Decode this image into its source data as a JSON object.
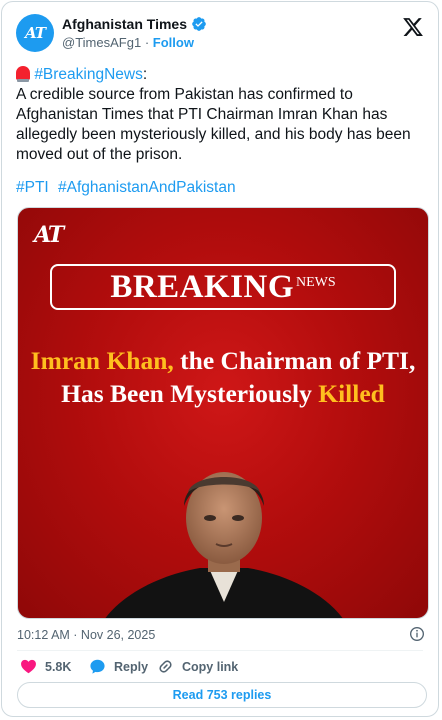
{
  "account": {
    "avatar_text": "AT",
    "name": "Afghanistan Times",
    "handle": "@TimesAFg1",
    "separator": "·",
    "follow_label": "Follow"
  },
  "tweet": {
    "breaking_tag": "#BreakingNews",
    "colon": ":",
    "body": "A credible source from Pakistan has confirmed to Afghanistan Times that PTI Chairman Imran Khan has allegedly been mysteriously killed, and his body has been moved out of the prison.",
    "hashtags": [
      "#PTI",
      "#AfghanistanAndPakistan"
    ]
  },
  "media": {
    "logo_text": "AT",
    "breaking_word": "BREAKING",
    "news_word": "NEWS",
    "headline_part1": "Imran Khan,",
    "headline_part2": " the Chairman of PTI, Has Been Mysteriously ",
    "headline_part3": "Killed"
  },
  "meta": {
    "timestamp": "10:12 AM · Nov 26, 2025"
  },
  "actions": {
    "like_count": "5.8K",
    "reply_label": "Reply",
    "copy_label": "Copy link"
  },
  "footer": {
    "read_replies_label": "Read 753 replies"
  },
  "colors": {
    "accent": "#1d9bf0",
    "like": "#f91880",
    "media_bg": "#b30d0d",
    "headline_highlight": "#ffbf1f"
  },
  "icons": [
    "verified-badge-icon",
    "x-logo-icon",
    "siren-icon",
    "info-icon",
    "heart-icon",
    "reply-bubble-icon",
    "link-icon"
  ]
}
